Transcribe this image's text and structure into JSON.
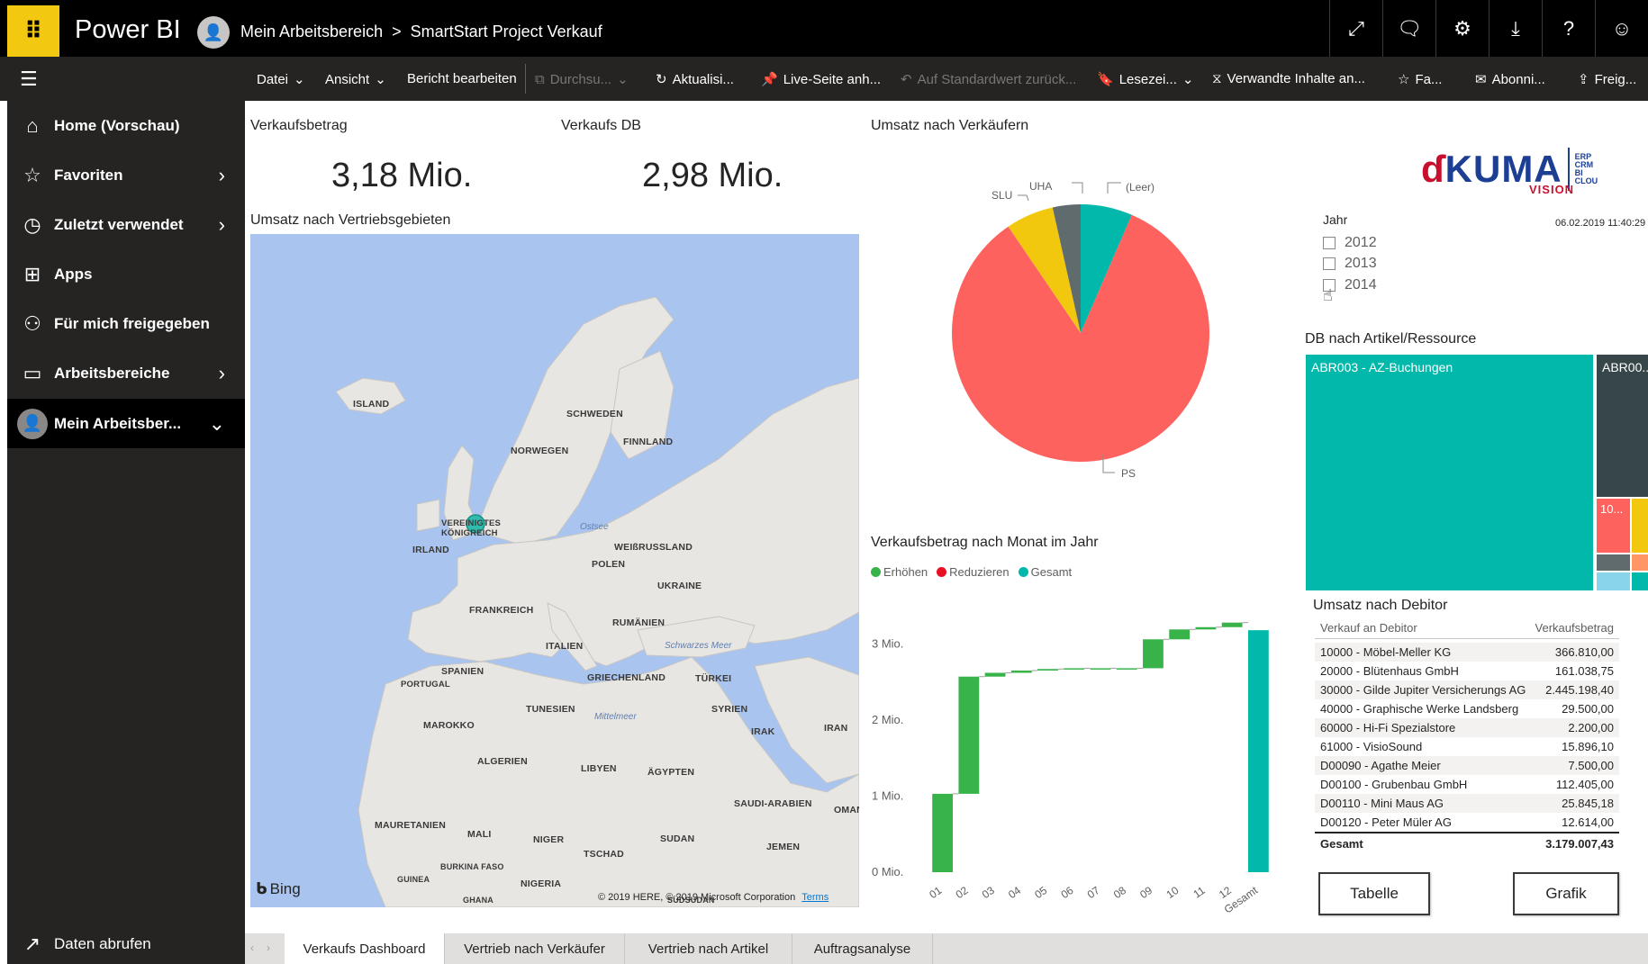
{
  "topbar": {
    "waffle_icon": "waffle-icon",
    "app_title": "Power BI",
    "breadcrumb": {
      "workspace": "Mein Arbeitsbereich",
      "separator": ">",
      "report": "SmartStart Project Verkauf"
    },
    "icons": [
      "expand-icon",
      "comment-icon",
      "gear-icon",
      "download-icon",
      "help-icon",
      "smiley-icon"
    ],
    "icon_glyphs": [
      "⤢",
      "🗨",
      "⚙",
      "⤓",
      "?",
      "☺"
    ]
  },
  "cmdbar": {
    "datei": "Datei",
    "ansicht": "Ansicht",
    "bericht_bearbeiten": "Bericht bearbeiten",
    "durchsuchen": "Durchsu...",
    "aktualisieren": "Aktualisi...",
    "live_seite": "Live-Seite anh...",
    "standardwert": "Auf Standardwert zurück...",
    "lesezeichen": "Lesezei...",
    "verwandte": "Verwandte Inhalte an...",
    "favorit": "Fa...",
    "abonnieren": "Abonni...",
    "freigeben": "Freig..."
  },
  "sidebar": {
    "items": [
      {
        "label": "Home (Vorschau)",
        "icon": "home-icon"
      },
      {
        "label": "Favoriten",
        "icon": "star-icon"
      },
      {
        "label": "Zuletzt verwendet",
        "icon": "clock-icon"
      },
      {
        "label": "Apps",
        "icon": "apps-icon"
      },
      {
        "label": "Für mich freigegeben",
        "icon": "shared-icon"
      },
      {
        "label": "Arbeitsbereiche",
        "icon": "workspaces-icon"
      },
      {
        "label": "Mein Arbeitsber...",
        "icon": "avatar-icon"
      }
    ],
    "footer": {
      "label": "Daten abrufen",
      "icon": "arrow-up-right-icon"
    }
  },
  "report": {
    "kpi1": {
      "title": "Verkaufsbetrag",
      "value": "3,18 Mio."
    },
    "kpi2": {
      "title": "Verkaufs DB",
      "value": "2,98 Mio."
    },
    "map": {
      "title": "Umsatz nach Vertriebsgebieten",
      "bing": "Bing",
      "copyright": "© 2019 HERE, © 2019 Microsoft Corporation",
      "terms": "Terms",
      "labels": [
        "ISLAND",
        "SCHWEDEN",
        "FINNLAND",
        "NORWEGEN",
        "VEREINIGTES KÖNIGREICH",
        "IRLAND",
        "WEIßRUSSLAND",
        "POLEN",
        "UKRAINE",
        "FRANKREICH",
        "RUMÄNIEN",
        "ITALIEN",
        "SPANIEN",
        "PORTUGAL",
        "GRIECHENLAND",
        "TÜRKEI",
        "TUNESIEN",
        "SYRIEN",
        "MAROKKO",
        "IRAK",
        "IRAN",
        "ALGERIEN",
        "LIBYEN",
        "ÄGYPTEN",
        "SAUDI-ARABIEN",
        "OMAN",
        "MAURETANIEN",
        "MALI",
        "NIGER",
        "TSCHAD",
        "SUDAN",
        "JEMEN",
        "BURKINA FASO",
        "GUINEA",
        "NIGERIA",
        "GHANA",
        "SÜDSUDAN"
      ],
      "seas": [
        "Ostsee",
        "Schwarzes Meer",
        "Mittelmeer"
      ]
    },
    "pie": {
      "title": "Umsatz nach Verkäufern",
      "chart_data": {
        "type": "pie",
        "categories": [
          "PS",
          "SLU",
          "UHA",
          "(Leer)"
        ],
        "values": [
          84,
          6,
          3.5,
          6.5
        ],
        "colors": [
          "#fd625e",
          "#f2c80f",
          "#5f6b6d",
          "#01b8aa"
        ]
      }
    },
    "logo": {
      "brand": "KUMA",
      "sub": "VISION",
      "tags": [
        "ERP",
        "CRM",
        "BI",
        "CLOU"
      ],
      "timestamp": "06.02.2019 11:40:29"
    },
    "slicer": {
      "title": "Jahr",
      "options": [
        "2012",
        "2013",
        "2014"
      ]
    },
    "treemap": {
      "title": "DB nach Artikel/Ressource",
      "cells": [
        "ABR003 - AZ-Buchungen",
        "ABR00...",
        "10..."
      ]
    },
    "waterfall": {
      "title": "Verkaufsbetrag nach Monat im Jahr",
      "legend": [
        {
          "label": "Erhöhen",
          "color": "#37b34a"
        },
        {
          "label": "Reduzieren",
          "color": "#e81123"
        },
        {
          "label": "Gesamt",
          "color": "#01b8aa"
        }
      ],
      "yticks": [
        "3 Mio.",
        "2 Mio.",
        "1 Mio.",
        "0 Mio."
      ],
      "chart_data": {
        "type": "bar",
        "categories": [
          "01",
          "02",
          "03",
          "04",
          "05",
          "06",
          "07",
          "08",
          "09",
          "10",
          "11",
          "12",
          "Gesamt"
        ],
        "values": [
          1.03,
          1.54,
          0.05,
          0.03,
          0.02,
          0.01,
          0.0,
          0.0,
          0.38,
          0.13,
          0.03,
          0.06,
          3.18
        ],
        "ylabel": "",
        "ylim": [
          0,
          3.3
        ]
      }
    },
    "table": {
      "title": "Umsatz nach Debitor",
      "columns": [
        "Verkauf an Debitor",
        "Verkaufsbetrag"
      ],
      "rows": [
        [
          "10000 - Möbel-Meller KG",
          "366.810,00"
        ],
        [
          "20000 - Blütenhaus GmbH",
          "161.038,75"
        ],
        [
          "30000 - Gilde Jupiter Versicherungs AG",
          "2.445.198,40"
        ],
        [
          "40000 - Graphische Werke Landsberg",
          "29.500,00"
        ],
        [
          "60000 - Hi-Fi Spezialstore",
          "2.200,00"
        ],
        [
          "61000 - VisioSound",
          "15.896,10"
        ],
        [
          "D00090 - Agathe Meier",
          "7.500,00"
        ],
        [
          "D00100 - Grubenbau GmbH",
          "112.405,00"
        ],
        [
          "D00110 - Mini Maus AG",
          "25.845,18"
        ],
        [
          "D00120 - Peter Müler AG",
          "12.614,00"
        ]
      ],
      "total": [
        "Gesamt",
        "3.179.007,43"
      ]
    },
    "buttons": {
      "tabelle": "Tabelle",
      "grafik": "Grafik"
    }
  },
  "tabs": [
    "Verkaufs Dashboard",
    "Vertrieb nach Verkäufer",
    "Vertrieb nach Artikel",
    "Auftragsanalyse"
  ]
}
